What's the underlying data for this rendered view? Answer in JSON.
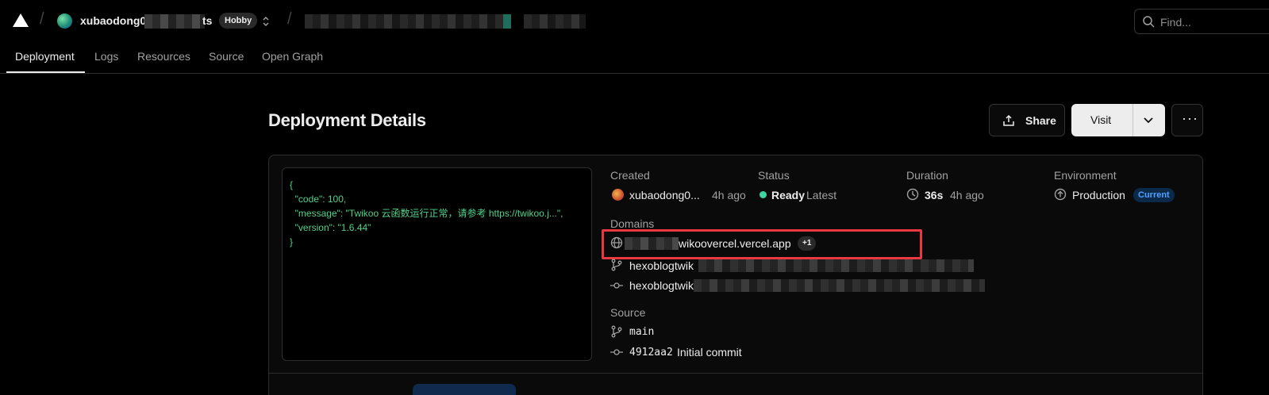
{
  "topbar": {
    "team_name": "xubaodong0",
    "team_name_tail": "ts",
    "plan_badge": "Hobby",
    "search_placeholder": "Find..."
  },
  "tabs": [
    {
      "label": "Deployment",
      "active": true
    },
    {
      "label": "Logs"
    },
    {
      "label": "Resources"
    },
    {
      "label": "Source"
    },
    {
      "label": "Open Graph"
    }
  ],
  "header": {
    "title": "Deployment Details",
    "share_label": "Share",
    "visit_label": "Visit",
    "more_label": "···"
  },
  "preview": {
    "lines": [
      "{",
      "  \"code\": 100,",
      "  \"message\": \"Twikoo 云函数运行正常，请参考 https://twikoo.j...\",",
      "  \"version\": \"1.6.44\"",
      "}"
    ]
  },
  "details": {
    "created_label": "Created",
    "created_user": "xubaodong0...",
    "created_time": "4h ago",
    "status_label": "Status",
    "status_value": "Ready",
    "status_tag": "Latest",
    "duration_label": "Duration",
    "duration_value": "36s",
    "duration_time": "4h ago",
    "environment_label": "Environment",
    "environment_value": "Production",
    "environment_badge": "Current",
    "domains_label": "Domains",
    "domain_primary": "wikoovercel.vercel.app",
    "domain_extra": "+1",
    "domain_branch": "hexoblogtwik",
    "domain_commit": "hexoblogtwik",
    "source_label": "Source",
    "source_branch": "main",
    "source_commit_hash": "4912aa2",
    "source_commit_msg": "Initial commit"
  },
  "colors": {
    "accent_ready": "#3fd4a2",
    "highlight_box": "#e9393f",
    "json_text": "#53d18a",
    "badge_current": "#4ea1ff"
  }
}
